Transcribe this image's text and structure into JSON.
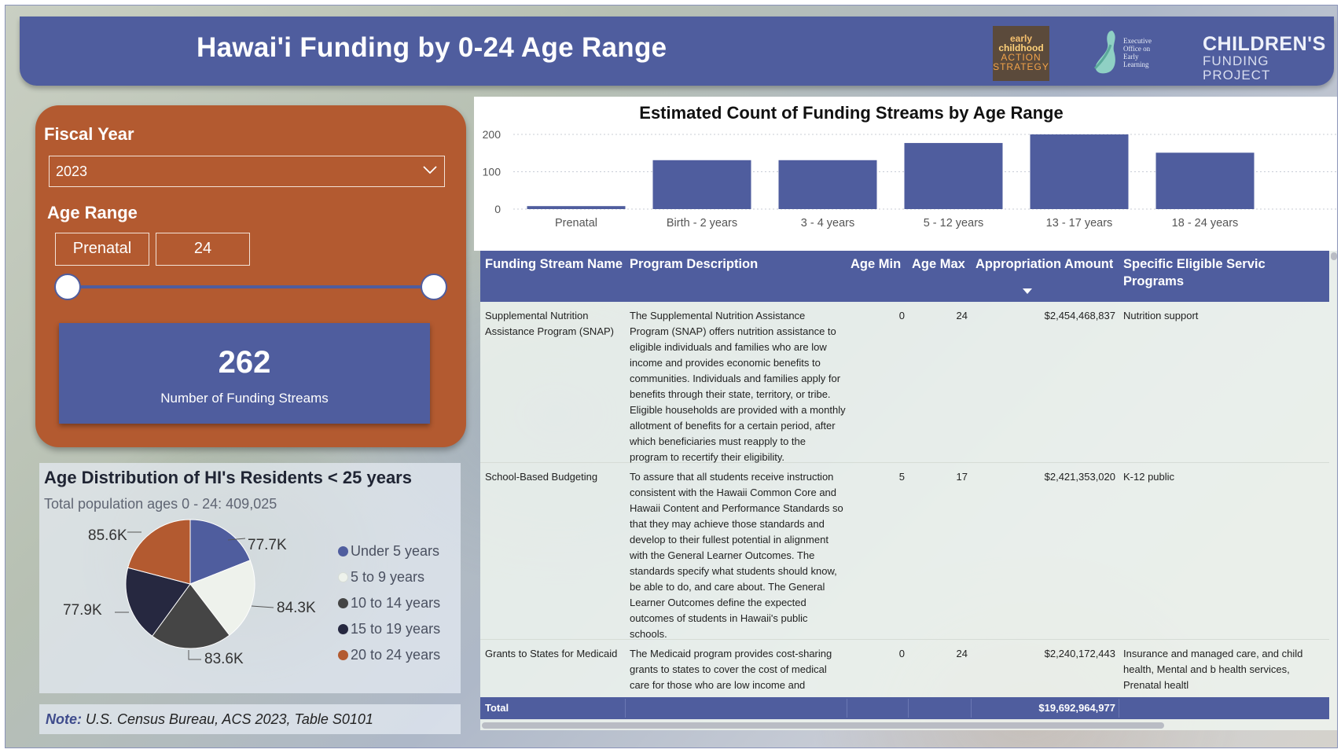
{
  "header": {
    "title": "Hawai'i Funding by 0-24 Age Range",
    "logos": {
      "ecas": {
        "line1": "early",
        "line2": "childhood",
        "line3": "ACTION",
        "line4": "STRATEGY"
      },
      "eoel": {
        "line1": "Executive",
        "line2": "Office on",
        "line3": "Early",
        "line4": "Learning"
      },
      "cfp": {
        "line1": "CHILDREN'S",
        "line2": "FUNDING PROJECT"
      }
    }
  },
  "filters": {
    "fiscal_year_label": "Fiscal Year",
    "fiscal_year_value": "2023",
    "age_range_label": "Age Range",
    "age_min": "Prenatal",
    "age_max": "24"
  },
  "kpi": {
    "value": "262",
    "label": "Number of Funding Streams"
  },
  "age_distribution": {
    "title": "Age Distribution of HI's Residents < 25 years",
    "subtitle": "Total population ages 0 - 24: 409,025",
    "note_label": "Note:",
    "note_text": "U.S. Census Bureau, ACS 2023, Table S0101"
  },
  "table": {
    "headers": [
      "Funding Stream Name",
      "Program Description",
      "Age Min",
      "Age Max",
      "Appropriation Amount",
      "Specific Eligible Servic",
      "Programs"
    ],
    "rows": [
      {
        "name": "Supplemental Nutrition Assistance Program (SNAP)",
        "description": "The Supplemental Nutrition Assistance Program (SNAP) offers nutrition assistance to eligible individuals and families who are low income and provides economic benefits to communities. Individuals and families apply for benefits through their state, territory, or tribe. Eligible households are provided with a monthly allotment of benefits for a certain period, after which beneficiaries must reapply to the program to recertify their eligibility.",
        "age_min": "0",
        "age_max": "24",
        "amount": "$2,454,468,837",
        "services": "Nutrition support"
      },
      {
        "name": "School-Based Budgeting",
        "description": "To assure that all students receive instruction consistent with the Hawaii Common Core and Hawaii Content and Performance Standards so that they may achieve those standards and develop to their fullest potential in alignment with the General Learner Outcomes. The standards specify what students should know, be able to do, and care about. The General Learner Outcomes define the expected outcomes of students in Hawaii's public schools.",
        "age_min": "5",
        "age_max": "17",
        "amount": "$2,421,353,020",
        "services": "K-12 public"
      },
      {
        "name": "Grants to States for Medicaid",
        "description": "The Medicaid program provides cost-sharing grants to states to cover the cost of medical care for those who are low income and",
        "age_min": "0",
        "age_max": "24",
        "amount": "$2,240,172,443",
        "services": "Insurance and managed care, and child health, Mental and b health services, Prenatal healtl"
      }
    ],
    "total_label": "Total",
    "total_amount": "$19,692,964,977"
  },
  "chart_data": [
    {
      "type": "bar",
      "title": "Estimated Count of Funding Streams by Age Range",
      "categories": [
        "Prenatal",
        "Birth - 2 years",
        "3 - 4 years",
        "5 - 12 years",
        "13 - 17 years",
        "18 - 24 years"
      ],
      "values": [
        8,
        131,
        131,
        177,
        200,
        151
      ],
      "ylim": [
        0,
        200
      ],
      "yticks": [
        "0",
        "100",
        "200"
      ],
      "grid": true,
      "color": "#4f5d9e"
    },
    {
      "type": "pie",
      "categories": [
        "Under 5 years",
        "5 to 9 years",
        "10 to 14 years",
        "15 to 19 years",
        "20 to 24 years"
      ],
      "values": [
        77.7,
        84.3,
        83.6,
        77.9,
        85.6
      ],
      "labels": [
        "77.7K",
        "84.3K",
        "83.6K",
        "77.9K",
        "85.6K"
      ],
      "colors": [
        "#4f5d9e",
        "#eef2ec",
        "#454545",
        "#262840",
        "#b35a30"
      ],
      "legend": "right"
    }
  ]
}
